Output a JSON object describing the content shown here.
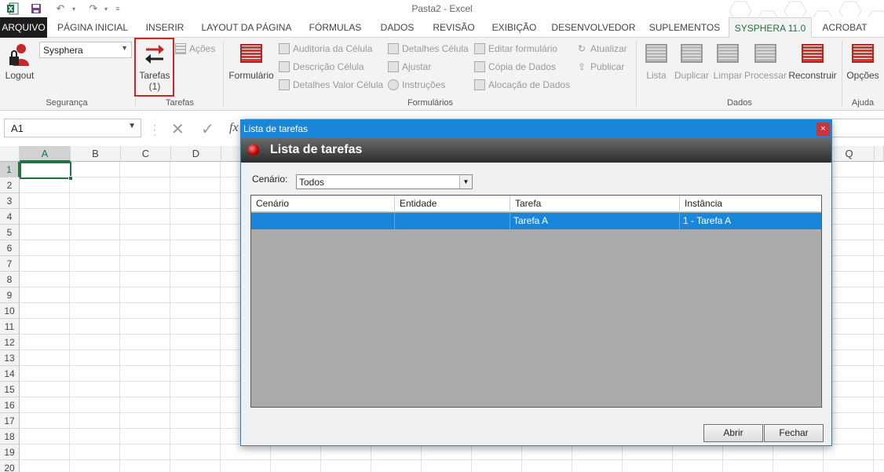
{
  "window": {
    "title": "Pasta2 - Excel"
  },
  "tabs": [
    "ARQUIVO",
    "PÁGINA INICIAL",
    "INSERIR",
    "LAYOUT DA PÁGINA",
    "FÓRMULAS",
    "DADOS",
    "REVISÃO",
    "EXIBIÇÃO",
    "DESENVOLVEDOR",
    "SUPLEMENTOS",
    "SYSPHERA 11.0",
    "ACROBAT"
  ],
  "ribbon": {
    "seguranca": {
      "dropdown_value": "Sysphera",
      "logout": "Logout",
      "label": "Segurança"
    },
    "tarefas": {
      "button": "Tarefas",
      "count": "(1)",
      "acoes": "Ações",
      "label": "Tarefas"
    },
    "formularios": {
      "formulario": "Formulário",
      "items": [
        "Auditoria da Célula",
        "Descrição Célula",
        "Detalhes Valor Célula",
        "Detalhes Célula",
        "Ajustar",
        "Instruções",
        "Editar formulário",
        "Cópia de Dados",
        "Alocação de Dados",
        "Atualizar",
        "Publicar"
      ],
      "label": "Formulários"
    },
    "dados": {
      "items": [
        "Lista",
        "Duplicar",
        "Limpar",
        "Processar",
        "Reconstruir"
      ],
      "label": "Dados"
    },
    "ajuda": {
      "opcoes": "Opções",
      "label": "Ajuda"
    }
  },
  "formula_bar": {
    "name_box": "A1",
    "fx": "fx"
  },
  "grid": {
    "columns": [
      "A",
      "B",
      "C",
      "D",
      "Q"
    ],
    "rows": [
      "1",
      "2",
      "3",
      "4",
      "5",
      "6",
      "7",
      "8",
      "9",
      "10",
      "11",
      "12",
      "13",
      "14",
      "15",
      "16",
      "17",
      "18",
      "19",
      "20"
    ]
  },
  "dialog": {
    "title": "Lista de tarefas",
    "header": "Lista de tarefas",
    "close": "×",
    "scenario_label": "Cenário:",
    "scenario_value": "Todos",
    "columns": [
      "Cenário",
      "Entidade",
      "Tarefa",
      "Instância"
    ],
    "rows": [
      {
        "cenario": "",
        "entidade": "",
        "tarefa": "Tarefa A",
        "instancia": "1 - Tarefa A"
      }
    ],
    "buttons": {
      "open": "Abrir",
      "close": "Fechar"
    }
  },
  "colors": {
    "accent_green": "#217346",
    "selection_blue": "#1a86d9",
    "highlight_red": "#d32323"
  }
}
